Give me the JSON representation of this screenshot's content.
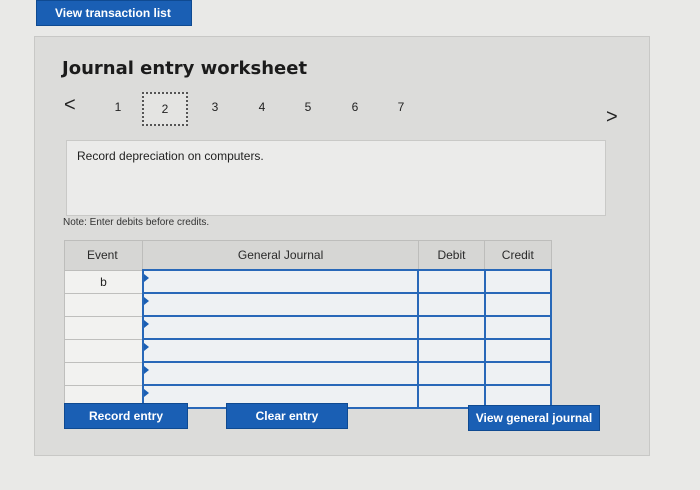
{
  "top_button": "View transaction list",
  "worksheet": {
    "title": "Journal entry worksheet",
    "nav": {
      "prev": "<",
      "next": ">",
      "pages": [
        "1",
        "2",
        "3",
        "4",
        "5",
        "6",
        "7"
      ],
      "selected": "2"
    },
    "instruction": "Record depreciation on computers.",
    "note": "Note: Enter debits before credits."
  },
  "table": {
    "headers": {
      "event": "Event",
      "general_journal": "General Journal",
      "debit": "Debit",
      "credit": "Credit"
    },
    "rows": [
      {
        "event": "b",
        "account": "",
        "debit": "",
        "credit": ""
      },
      {
        "event": "",
        "account": "",
        "debit": "",
        "credit": ""
      },
      {
        "event": "",
        "account": "",
        "debit": "",
        "credit": ""
      },
      {
        "event": "",
        "account": "",
        "debit": "",
        "credit": ""
      },
      {
        "event": "",
        "account": "",
        "debit": "",
        "credit": ""
      },
      {
        "event": "",
        "account": "",
        "debit": "",
        "credit": ""
      }
    ]
  },
  "buttons": {
    "record": "Record entry",
    "clear": "Clear entry",
    "view_journal": "View general journal"
  },
  "colors": {
    "accent": "#1a5fb4",
    "panel": "#dcdcda"
  }
}
